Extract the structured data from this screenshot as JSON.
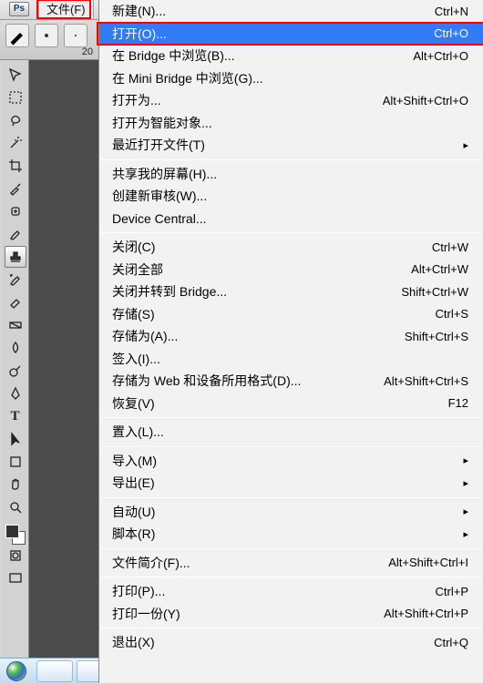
{
  "titlebar": {
    "ps_label": "Ps",
    "file_label": "文件(F)"
  },
  "option_bar": {
    "size_value": "20"
  },
  "menu_groups": [
    [
      {
        "label": "新建(N)...",
        "accel": "Ctrl+N",
        "highlighted": false
      },
      {
        "label": "打开(O)...",
        "accel": "Ctrl+O",
        "highlighted": true
      },
      {
        "label": "在 Bridge 中浏览(B)...",
        "accel": "Alt+Ctrl+O"
      },
      {
        "label": "在 Mini Bridge 中浏览(G)..."
      },
      {
        "label": "打开为...",
        "accel": "Alt+Shift+Ctrl+O"
      },
      {
        "label": "打开为智能对象..."
      },
      {
        "label": "最近打开文件(T)",
        "submenu": true
      }
    ],
    [
      {
        "label": "共享我的屏幕(H)..."
      },
      {
        "label": "创建新审核(W)..."
      },
      {
        "label": "Device Central..."
      }
    ],
    [
      {
        "label": "关闭(C)",
        "accel": "Ctrl+W"
      },
      {
        "label": "关闭全部",
        "accel": "Alt+Ctrl+W"
      },
      {
        "label": "关闭并转到 Bridge...",
        "accel": "Shift+Ctrl+W"
      },
      {
        "label": "存储(S)",
        "accel": "Ctrl+S"
      },
      {
        "label": "存储为(A)...",
        "accel": "Shift+Ctrl+S"
      },
      {
        "label": "签入(I)..."
      },
      {
        "label": "存储为 Web 和设备所用格式(D)...",
        "accel": "Alt+Shift+Ctrl+S"
      },
      {
        "label": "恢复(V)",
        "accel": "F12"
      }
    ],
    [
      {
        "label": "置入(L)..."
      }
    ],
    [
      {
        "label": "导入(M)",
        "submenu": true
      },
      {
        "label": "导出(E)",
        "submenu": true
      }
    ],
    [
      {
        "label": "自动(U)",
        "submenu": true
      },
      {
        "label": "脚本(R)",
        "submenu": true
      }
    ],
    [
      {
        "label": "文件简介(F)...",
        "accel": "Alt+Shift+Ctrl+I"
      }
    ],
    [
      {
        "label": "打印(P)...",
        "accel": "Ctrl+P"
      },
      {
        "label": "打印一份(Y)",
        "accel": "Alt+Shift+Ctrl+P"
      }
    ],
    [
      {
        "label": "退出(X)",
        "accel": "Ctrl+Q"
      }
    ]
  ],
  "tools": [
    "move",
    "marquee",
    "lasso",
    "wand",
    "crop",
    "eyedropper",
    "healing",
    "brush",
    "stamp",
    "history-brush",
    "eraser",
    "gradient",
    "blur",
    "dodge",
    "pen",
    "type",
    "path-select",
    "rectangle",
    "hand",
    "zoom"
  ]
}
